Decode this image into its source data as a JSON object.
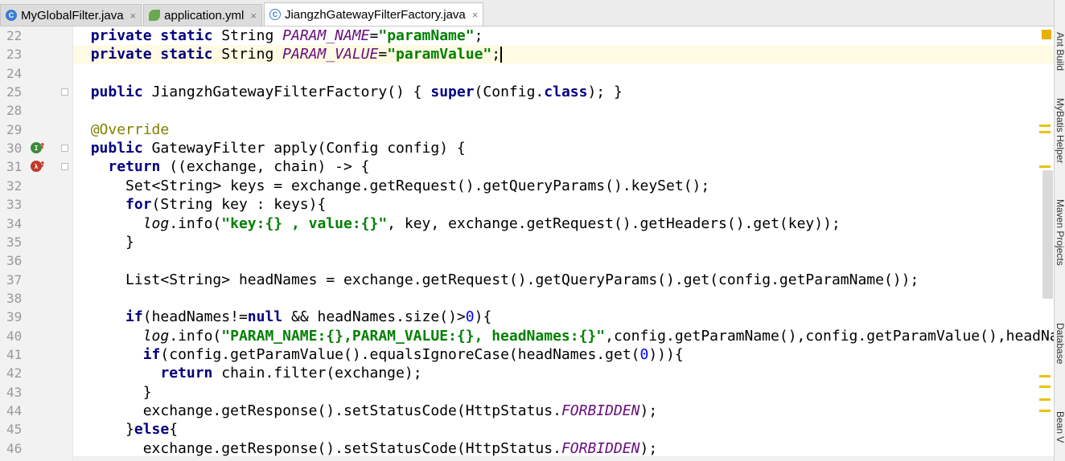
{
  "tabs": [
    {
      "label": "MyGlobalFilter.java",
      "icon": "java-class-icon",
      "close": "×"
    },
    {
      "label": "application.yml",
      "icon": "yaml-spring-icon",
      "close": "×"
    },
    {
      "label": "JiangzhGatewayFilterFactory.java",
      "icon": "java-class-icon",
      "close": "×",
      "active": true
    }
  ],
  "tab_icon_letter": "C",
  "right_tools": [
    "Ant Build",
    "MyBatis Helper",
    "Maven Projects",
    "Database",
    "Bean V"
  ],
  "lines": [
    {
      "n": "22",
      "t": [
        [
          "",
          "  private static String "
        ],
        [
          "fld",
          "PARAM_NAME"
        ],
        [
          "",
          "="
        ],
        [
          "str",
          "\"paramName\""
        ],
        [
          "",
          ";"
        ]
      ]
    },
    {
      "n": "23",
      "t": [
        [
          "",
          "  private static String "
        ],
        [
          "fld",
          "PARAM_VALUE"
        ],
        [
          "",
          "="
        ],
        [
          "str",
          "\"paramValue\""
        ],
        [
          "",
          ";"
        ]
      ]
    },
    {
      "n": "24",
      "t": [
        [
          "",
          ""
        ]
      ]
    },
    {
      "n": "25",
      "t": [
        [
          "",
          "  public JiangzhGatewayFilterFactory() { super(Config.class); }"
        ]
      ]
    },
    {
      "n": "28",
      "t": [
        [
          "",
          ""
        ]
      ]
    },
    {
      "n": "29",
      "t": [
        [
          "",
          "  @Override"
        ]
      ]
    },
    {
      "n": "30",
      "t": [
        [
          "",
          "  public GatewayFilter apply(Config config) {"
        ]
      ]
    },
    {
      "n": "31",
      "t": [
        [
          "",
          "    return ((exchange, chain) -> {"
        ]
      ]
    },
    {
      "n": "32",
      "t": [
        [
          "",
          "      Set<String> keys = exchange.getRequest().getQueryParams().keySet();"
        ]
      ]
    },
    {
      "n": "33",
      "t": [
        [
          "",
          "      for(String key : keys){"
        ]
      ]
    },
    {
      "n": "34",
      "t": [
        [
          "",
          "        log.info(\"key:{} , value:{}\", key, exchange.getRequest().getHeaders().get(key));"
        ]
      ]
    },
    {
      "n": "35",
      "t": [
        [
          "",
          "      }"
        ]
      ]
    },
    {
      "n": "36",
      "t": [
        [
          "",
          ""
        ]
      ]
    },
    {
      "n": "37",
      "t": [
        [
          "",
          "      List<String> headNames = exchange.getRequest().getQueryParams().get(config.getParamName());"
        ]
      ]
    },
    {
      "n": "38",
      "t": [
        [
          "",
          ""
        ]
      ]
    },
    {
      "n": "39",
      "t": [
        [
          "",
          "      if(headNames!=null && headNames.size()>0){"
        ]
      ]
    },
    {
      "n": "40",
      "t": [
        [
          "",
          "        log.info(\"PARAM_NAME:{},PARAM_VALUE:{}, headNames:{}\",config.getParamName(),config.getParamValue(),headNames"
        ]
      ]
    },
    {
      "n": "41",
      "t": [
        [
          "",
          "        if(config.getParamValue().equalsIgnoreCase(headNames.get(0))){"
        ]
      ]
    },
    {
      "n": "42",
      "t": [
        [
          "",
          "          return chain.filter(exchange);"
        ]
      ]
    },
    {
      "n": "43",
      "t": [
        [
          "",
          "        }"
        ]
      ]
    },
    {
      "n": "44",
      "t": [
        [
          "",
          "        exchange.getResponse().setStatusCode(HttpStatus.FORBIDDEN);"
        ]
      ]
    },
    {
      "n": "45",
      "t": [
        [
          "",
          "      }else{"
        ]
      ]
    },
    {
      "n": "46",
      "t": [
        [
          "",
          "        exchange.getResponse().setStatusCode(HttpStatus.FORBIDDEN);"
        ]
      ]
    }
  ]
}
